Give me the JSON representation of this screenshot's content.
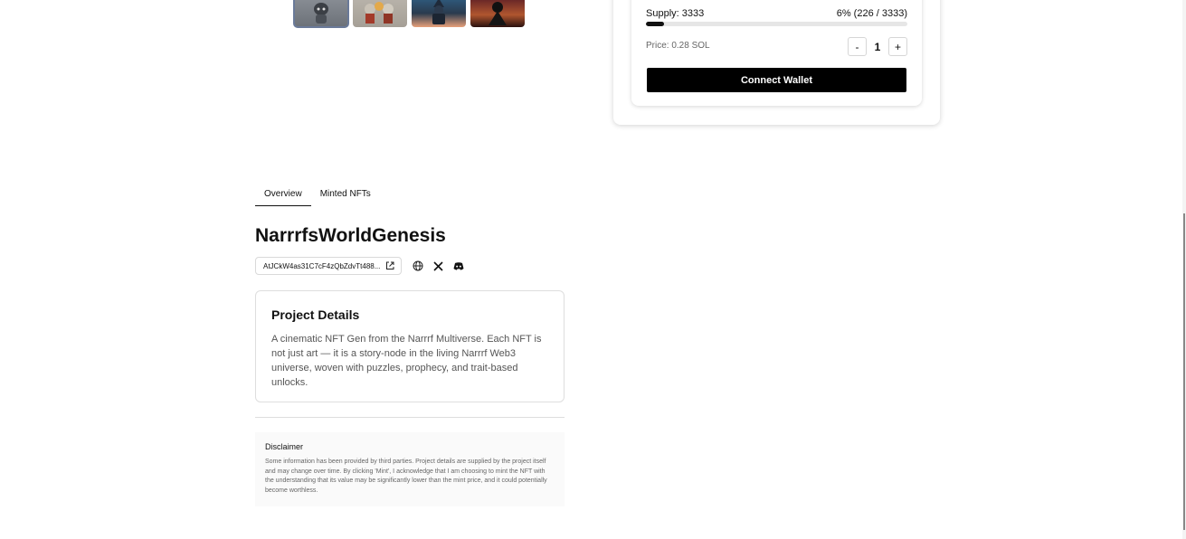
{
  "gallery": {
    "thumbnails": [
      "nft-image-1",
      "nft-image-2",
      "nft-image-3",
      "nft-image-4"
    ],
    "active_index": 0
  },
  "mint": {
    "supply_label": "Supply: 3333",
    "progress_label": "6% (226 / 3333)",
    "progress_fraction": 0.068,
    "price_label": "Price: 0.28 SOL",
    "decrement_label": "-",
    "quantity": "1",
    "increment_label": "+",
    "connect_label": "Connect Wallet"
  },
  "tabs": [
    {
      "label": "Overview",
      "active": true
    },
    {
      "label": "Minted NFTs",
      "active": false
    }
  ],
  "collection": {
    "name": "NarrrfsWorldGenesis",
    "address": "AtJCkW4as31C7cF4zQbZdvTt488...",
    "icons": [
      "external-link-icon",
      "globe-icon",
      "x-icon",
      "discord-icon"
    ]
  },
  "details": {
    "heading": "Project Details",
    "description": "A cinematic NFT Gen from the Narrrf Multiverse. Each NFT is not just art — it is a story-node in the living Narrrf Web3 universe, woven with puzzles, prophecy, and trait-based unlocks."
  },
  "disclaimer": {
    "heading": "Disclaimer",
    "text": "Some information has been provided by third parties. Project details are supplied by the project itself and may change over time. By clicking 'Mint', I acknowledge that I am choosing to mint the NFT with the understanding that its value may be significantly lower than the mint price, and it could potentially become worthless."
  },
  "colors": {
    "accent": "#000000",
    "progress_track": "#e6e6e6",
    "muted_text": "#555555"
  }
}
